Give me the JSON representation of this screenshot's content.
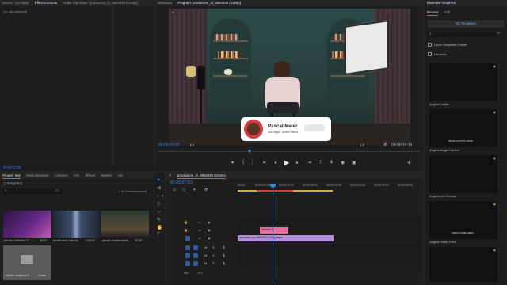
{
  "top_tabs": {
    "source": "Source: (no clips)",
    "effect_controls": "Effect Controls",
    "audio_mixer": "Audio Clip Mixer: production_id_4994039 (2160p)",
    "metadata": "Metadata",
    "program": "Program: production_id_4994039 (2160p)",
    "essential_graphics": "Essential Graphics"
  },
  "effect_controls": {
    "empty_text": "(no clip selected)",
    "timecode": "00:00:07:03"
  },
  "program": {
    "lower_third": {
      "name": "Pascal Meier",
      "subtitle": "Las Vegas, United States",
      "button": ""
    },
    "timecode_left": "00:00:07:03",
    "fit": "Fit",
    "resolution": "1/2",
    "timecode_right": "00:00:19:19",
    "transport_icons": [
      "marker-icon",
      "in-point-icon",
      "out-point-icon",
      "go-to-in-icon",
      "step-back-icon",
      "play-icon",
      "step-forward-icon",
      "go-to-out-icon",
      "lift-icon",
      "extract-icon",
      "export-frame-icon",
      "compare-icon",
      "settings-icon",
      "add-icon"
    ]
  },
  "project": {
    "tabs": [
      "Project: test",
      "Media Browser",
      "Libraries",
      "Info",
      "Effects",
      "Marker",
      "His"
    ],
    "file_name": "test.prproj",
    "selection_info": "1 of 7 items selected",
    "items": [
      {
        "name": "pexels-cottonbro-5...",
        "duration": "46:03",
        "color": "#5a2f7a",
        "accent": "#c05ab0"
      },
      {
        "name": "pexels-max-leta-ph...",
        "duration": "1:00:07",
        "color": "#3a4a66",
        "accent": "#8aa0c8"
      },
      {
        "name": "pexels-koolshooters...",
        "duration": "19:19",
        "color": "#3c3a2e",
        "accent": "#8a6f46"
      },
      {
        "name": "Motion Graphics T...",
        "duration": "1 item",
        "color": "#5a5a5a",
        "accent": "#9b9b9b"
      }
    ]
  },
  "tools": [
    "selection-tool-icon",
    "track-select-icon",
    "ripple-edit-icon",
    "razor-icon",
    "slip-icon",
    "pen-icon",
    "hand-icon",
    "type-icon"
  ],
  "timeline": {
    "tab": "production_id_4994039 (2160p)",
    "timecode": "00:00:07:03",
    "ruler": [
      "00:00",
      "00:00:05:00",
      "00:00:10:00",
      "00:00:15:00",
      "00:00:20:00",
      "00:00:25:00",
      "00:00:30:00",
      "00:00:35:00"
    ],
    "tracks": [
      {
        "id": "V3",
        "type": "video"
      },
      {
        "id": "V2",
        "type": "video"
      },
      {
        "id": "V1",
        "type": "video"
      },
      {
        "id": "A1",
        "type": "audio"
      },
      {
        "id": "A2",
        "type": "audio"
      },
      {
        "id": "A3",
        "type": "audio"
      },
      {
        "id": "Mix",
        "type": "mix",
        "value": "0.0"
      }
    ],
    "clips": [
      {
        "label": "Notable ID",
        "track": "V2"
      },
      {
        "label": "production_id_4994039 (2160p).mp4",
        "track": "V1"
      }
    ]
  },
  "essential_graphics": {
    "tabs": [
      "Browse",
      "Edit"
    ],
    "my_templates": "My Templates",
    "search_placeholder": "",
    "local_templates": "Local Templates Folder",
    "libraries": "Libraries",
    "templates": [
      {
        "name": "Angled Credits",
        "preview": ""
      },
      {
        "name": "Angled Image Caption",
        "preview": "IMAGE CAPTION HERE"
      },
      {
        "name": "Angled Line Overlay",
        "preview": ""
      },
      {
        "name": "Angled Lower Third",
        "preview": "INSERT NAME HERE"
      },
      {
        "name": "",
        "preview": ""
      }
    ]
  },
  "colors": {
    "accent_blue": "#2d8ceb",
    "playhead": "#3d7fd9",
    "clip_v2": "#e66fa2",
    "clip_v1": "#b48fe0",
    "lower_third_red": "#d63a3a"
  }
}
